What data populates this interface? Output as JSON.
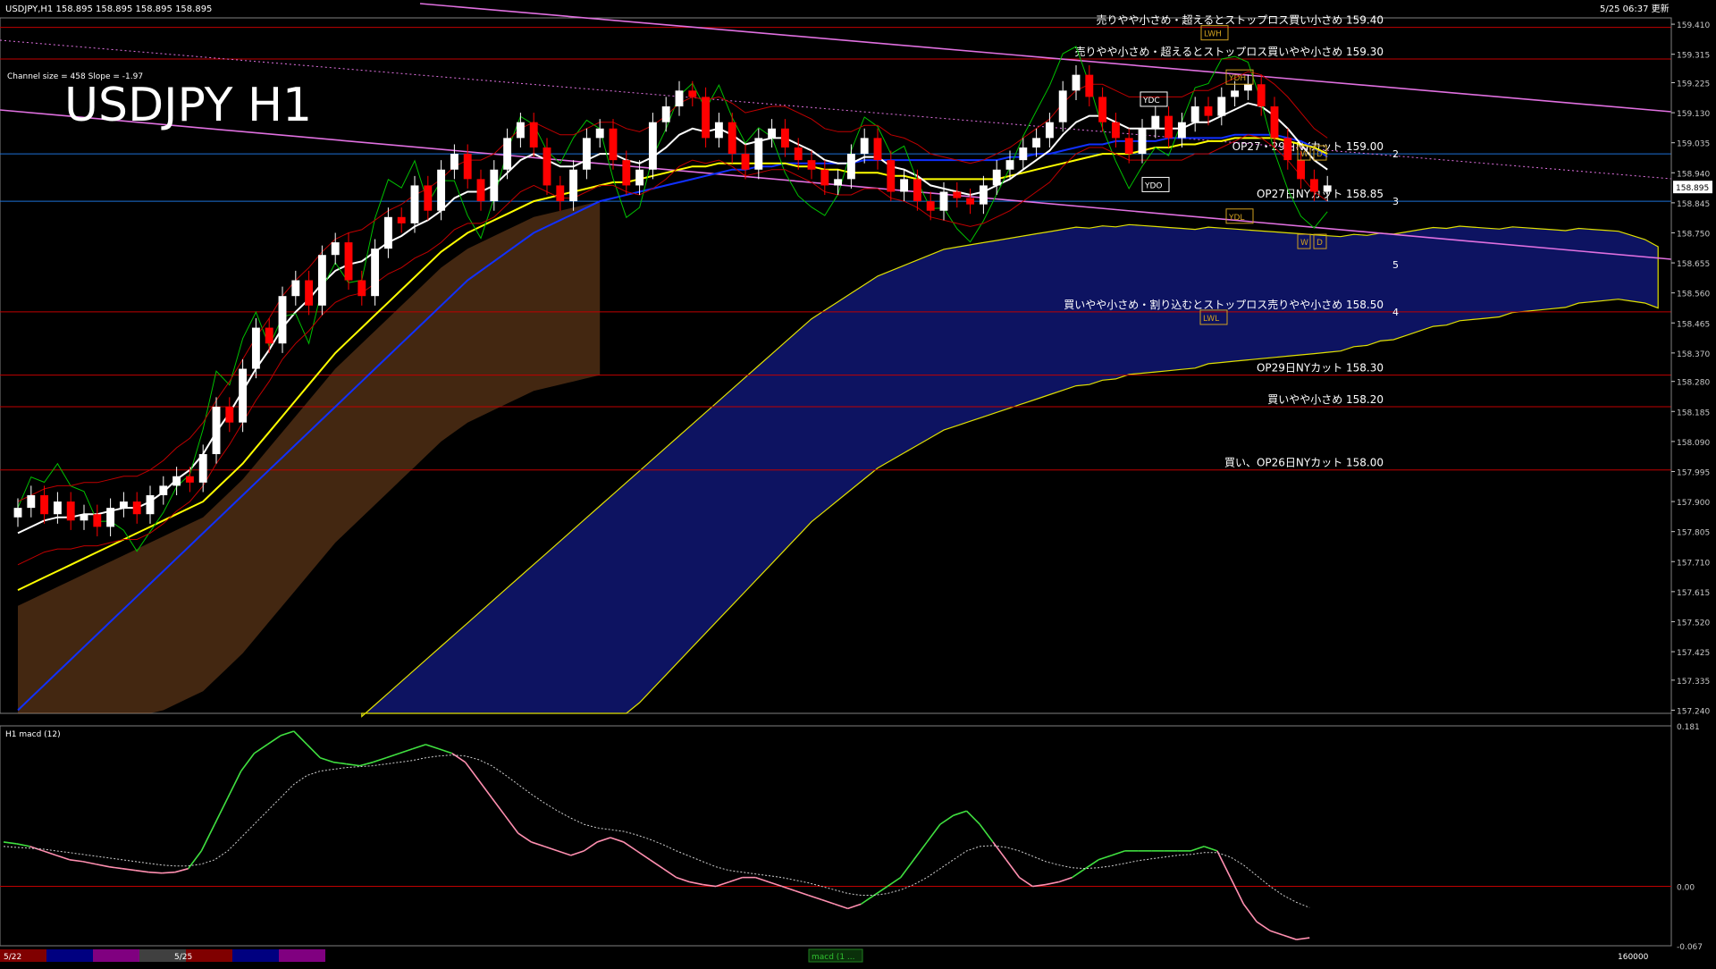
{
  "window": {
    "symbol_line": "USDJPY,H1  158.895 158.895 158.895 158.895",
    "clock": "5/25 06:37 更新",
    "title": "USDJPY H1",
    "channel_info": "Channel size = 458 Slope = -1.97"
  },
  "colors": {
    "background": "#000000",
    "grid_level": "#c00000",
    "level_blue": "#1e6fd6",
    "channel_line": "#e070e0",
    "ema_white": "#ffffff",
    "ema_yellow": "#ffff00",
    "ema_blue": "#1030ff",
    "bull_candle": "#ffffff",
    "bear_candle": "#ff0000",
    "ichimoku_green": "#00c000",
    "kumo_blue": "#1c2ad6",
    "kumo_orange": "#c07030",
    "macd_up": "#40e040",
    "macd_down": "#ff8fb0",
    "signal_dotted": "#d0d0d0",
    "axis_text": "#c8c8c8"
  },
  "chart_data": [
    {
      "type": "candlestick",
      "name": "main-price-pane",
      "y_ticks": [
        "159.410",
        "159.315",
        "159.225",
        "159.130",
        "159.035",
        "158.940",
        "158.845",
        "158.750",
        "158.655",
        "158.560",
        "158.465",
        "158.370",
        "158.280",
        "158.185",
        "158.090",
        "157.995",
        "157.900",
        "157.805",
        "157.710",
        "157.615",
        "157.520",
        "157.425",
        "157.335",
        "157.240"
      ],
      "ylim": [
        157.23,
        159.43
      ],
      "current_price": "158.895",
      "annotation_levels": [
        {
          "price": 159.4,
          "label": "売りやや小さめ・超えるとストップロス買い小さめ 159.40"
        },
        {
          "price": 159.3,
          "label": "売りやや小さめ・超えるとストップロス買いやや小さめ 159.30"
        },
        {
          "price": 159.0,
          "label": "OP27・29日NYカット 159.00"
        },
        {
          "price": 158.85,
          "label": "OP27日NYカット 158.85"
        },
        {
          "price": 158.5,
          "label": "買いやや小さめ・割り込むとストップロス売りやや小さめ 158.50"
        },
        {
          "price": 158.3,
          "label": "OP29日NYカット 158.30"
        },
        {
          "price": 158.2,
          "label": "買いやや小さめ 158.20"
        },
        {
          "price": 158.0,
          "label": "買い、OP26日NYカット 158.00"
        }
      ],
      "box_labels": [
        "LWH",
        "YDH",
        "YDC",
        "YDO",
        "YDL",
        "LWL",
        "W",
        "D",
        "W",
        "D"
      ],
      "wave_labels": [
        "2",
        "3",
        "4",
        "5"
      ],
      "candles_close": [
        157.88,
        157.92,
        157.86,
        157.9,
        157.84,
        157.86,
        157.82,
        157.88,
        157.9,
        157.86,
        157.92,
        157.95,
        157.98,
        157.96,
        158.05,
        158.2,
        158.15,
        158.32,
        158.45,
        158.4,
        158.55,
        158.6,
        158.52,
        158.68,
        158.72,
        158.6,
        158.55,
        158.7,
        158.8,
        158.78,
        158.9,
        158.82,
        158.95,
        159.0,
        158.92,
        158.85,
        158.95,
        159.05,
        159.1,
        159.02,
        158.9,
        158.85,
        158.95,
        159.05,
        159.08,
        158.98,
        158.9,
        158.95,
        159.1,
        159.15,
        159.2,
        159.18,
        159.05,
        159.1,
        159.0,
        158.95,
        159.05,
        159.08,
        159.02,
        158.98,
        158.95,
        158.9,
        158.92,
        159.0,
        159.05,
        158.98,
        158.88,
        158.92,
        158.85,
        158.82,
        158.88,
        158.86,
        158.84,
        158.9,
        158.95,
        158.98,
        159.02,
        159.05,
        159.1,
        159.2,
        159.25,
        159.18,
        159.1,
        159.05,
        159.0,
        159.08,
        159.12,
        159.05,
        159.1,
        159.15,
        159.12,
        159.18,
        159.2,
        159.22,
        159.15,
        159.05,
        158.98,
        158.92,
        158.88,
        158.9
      ],
      "ema_white": [
        157.8,
        157.82,
        157.84,
        157.85,
        157.85,
        157.86,
        157.86,
        157.87,
        157.88,
        157.88,
        157.9,
        157.93,
        157.97,
        158.0,
        158.05,
        158.12,
        158.18,
        158.25,
        158.32,
        158.38,
        158.45,
        158.5,
        158.54,
        158.59,
        158.63,
        158.65,
        158.66,
        158.69,
        158.72,
        158.74,
        158.77,
        158.79,
        158.82,
        158.86,
        158.88,
        158.88,
        158.9,
        158.94,
        158.98,
        159.0,
        158.98,
        158.96,
        158.96,
        158.98,
        159.0,
        159.0,
        158.98,
        158.97,
        158.99,
        159.02,
        159.06,
        159.08,
        159.07,
        159.08,
        159.06,
        159.03,
        159.04,
        159.05,
        159.05,
        159.03,
        159.01,
        158.98,
        158.97,
        158.97,
        158.99,
        158.99,
        158.96,
        158.95,
        158.93,
        158.9,
        158.89,
        158.88,
        158.87,
        158.88,
        158.9,
        158.92,
        158.95,
        158.98,
        159.01,
        159.06,
        159.1,
        159.12,
        159.12,
        159.1,
        159.08,
        159.08,
        159.08,
        159.08,
        159.08,
        159.1,
        159.1,
        159.12,
        159.14,
        159.16,
        159.15,
        159.12,
        159.08,
        159.03,
        158.98,
        158.95
      ],
      "ema_yellow": [
        157.62,
        157.64,
        157.66,
        157.68,
        157.7,
        157.72,
        157.74,
        157.76,
        157.78,
        157.8,
        157.82,
        157.84,
        157.86,
        157.88,
        157.9,
        157.94,
        157.98,
        158.02,
        158.07,
        158.12,
        158.17,
        158.22,
        158.27,
        158.32,
        158.37,
        158.41,
        158.45,
        158.49,
        158.53,
        158.57,
        158.61,
        158.65,
        158.69,
        158.72,
        158.75,
        158.77,
        158.79,
        158.81,
        158.83,
        158.85,
        158.86,
        158.87,
        158.88,
        158.89,
        158.9,
        158.91,
        158.91,
        158.92,
        158.93,
        158.94,
        158.95,
        158.96,
        158.96,
        158.97,
        158.97,
        158.97,
        158.97,
        158.97,
        158.97,
        158.96,
        158.96,
        158.95,
        158.95,
        158.94,
        158.94,
        158.94,
        158.93,
        158.93,
        158.92,
        158.92,
        158.92,
        158.92,
        158.92,
        158.92,
        158.92,
        158.93,
        158.94,
        158.95,
        158.96,
        158.97,
        158.98,
        158.99,
        159.0,
        159.0,
        159.0,
        159.01,
        159.02,
        159.02,
        159.03,
        159.03,
        159.04,
        159.04,
        159.05,
        159.05,
        159.05,
        159.05,
        159.04,
        159.03,
        159.02,
        159.0
      ],
      "ema_blue": [
        157.24,
        157.28,
        157.32,
        157.36,
        157.4,
        157.44,
        157.48,
        157.52,
        157.56,
        157.6,
        157.64,
        157.68,
        157.72,
        157.76,
        157.8,
        157.84,
        157.88,
        157.92,
        157.96,
        158.0,
        158.04,
        158.08,
        158.12,
        158.16,
        158.2,
        158.24,
        158.28,
        158.32,
        158.36,
        158.4,
        158.44,
        158.48,
        158.52,
        158.56,
        158.6,
        158.63,
        158.66,
        158.69,
        158.72,
        158.75,
        158.77,
        158.79,
        158.81,
        158.83,
        158.85,
        158.86,
        158.87,
        158.88,
        158.89,
        158.9,
        158.91,
        158.92,
        158.93,
        158.94,
        158.95,
        158.95,
        158.96,
        158.96,
        158.97,
        158.97,
        158.97,
        158.97,
        158.97,
        158.97,
        158.98,
        158.98,
        158.98,
        158.98,
        158.98,
        158.98,
        158.98,
        158.98,
        158.98,
        158.98,
        158.98,
        158.99,
        158.99,
        159.0,
        159.0,
        159.01,
        159.02,
        159.03,
        159.03,
        159.04,
        159.04,
        159.04,
        159.04,
        159.05,
        159.05,
        159.05,
        159.05,
        159.05,
        159.06,
        159.06,
        159.06,
        159.06,
        159.05,
        159.04,
        159.02,
        158.99
      ]
    },
    {
      "type": "line",
      "name": "macd-pane",
      "title": "H1  macd (12)",
      "y_ticks": [
        "0.181",
        "0.00",
        "-0.067"
      ],
      "ylim": [
        -0.067,
        0.181
      ],
      "macd": [
        0.05,
        0.048,
        0.045,
        0.04,
        0.035,
        0.03,
        0.028,
        0.025,
        0.022,
        0.02,
        0.018,
        0.016,
        0.015,
        0.016,
        0.02,
        0.04,
        0.07,
        0.1,
        0.13,
        0.15,
        0.16,
        0.17,
        0.175,
        0.16,
        0.145,
        0.14,
        0.138,
        0.136,
        0.14,
        0.145,
        0.15,
        0.155,
        0.16,
        0.155,
        0.15,
        0.14,
        0.12,
        0.1,
        0.08,
        0.06,
        0.05,
        0.045,
        0.04,
        0.035,
        0.04,
        0.05,
        0.055,
        0.05,
        0.04,
        0.03,
        0.02,
        0.01,
        0.005,
        0.002,
        0.0,
        0.005,
        0.01,
        0.01,
        0.005,
        0.0,
        -0.005,
        -0.01,
        -0.015,
        -0.02,
        -0.025,
        -0.02,
        -0.01,
        0.0,
        0.01,
        0.03,
        0.05,
        0.07,
        0.08,
        0.085,
        0.07,
        0.05,
        0.03,
        0.01,
        0.0,
        0.002,
        0.005,
        0.01,
        0.02,
        0.03,
        0.035,
        0.04,
        0.04,
        0.04,
        0.04,
        0.04,
        0.04,
        0.045,
        0.04,
        0.01,
        -0.02,
        -0.04,
        -0.05,
        -0.055,
        -0.06,
        -0.058
      ],
      "signal": [
        0.045,
        0.044,
        0.043,
        0.042,
        0.04,
        0.038,
        0.036,
        0.034,
        0.032,
        0.03,
        0.028,
        0.026,
        0.024,
        0.023,
        0.023,
        0.025,
        0.03,
        0.04,
        0.055,
        0.07,
        0.085,
        0.1,
        0.115,
        0.125,
        0.13,
        0.132,
        0.134,
        0.135,
        0.136,
        0.138,
        0.14,
        0.142,
        0.145,
        0.147,
        0.148,
        0.147,
        0.143,
        0.136,
        0.126,
        0.115,
        0.104,
        0.094,
        0.085,
        0.077,
        0.07,
        0.066,
        0.064,
        0.062,
        0.058,
        0.053,
        0.047,
        0.04,
        0.034,
        0.028,
        0.022,
        0.018,
        0.016,
        0.014,
        0.012,
        0.01,
        0.007,
        0.004,
        0.0,
        -0.004,
        -0.008,
        -0.01,
        -0.01,
        -0.008,
        -0.004,
        0.002,
        0.01,
        0.02,
        0.03,
        0.04,
        0.045,
        0.046,
        0.044,
        0.04,
        0.034,
        0.028,
        0.024,
        0.021,
        0.02,
        0.021,
        0.023,
        0.026,
        0.029,
        0.031,
        0.033,
        0.035,
        0.036,
        0.038,
        0.038,
        0.033,
        0.024,
        0.012,
        0.0,
        -0.01,
        -0.018,
        -0.024
      ]
    }
  ],
  "bottom_bar": {
    "date_left": "5/22",
    "date_mid": "5/25",
    "tab_label": "macd (1 ...",
    "right_value": "160000"
  }
}
